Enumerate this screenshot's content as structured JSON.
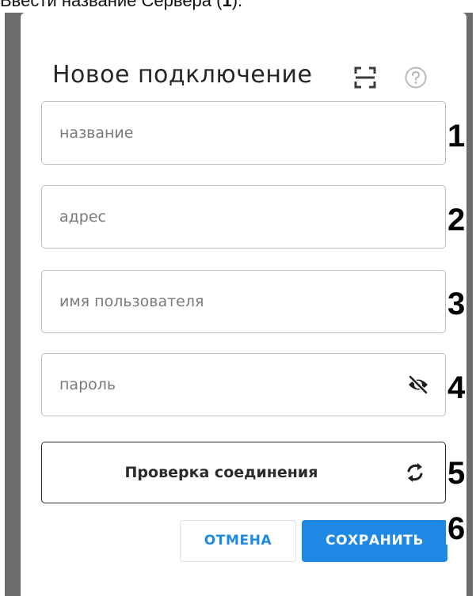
{
  "caption": {
    "text": "Ввести название Сервера (",
    "bold": "1",
    "tail": ")."
  },
  "dialog": {
    "title": "Новое подключение",
    "scan_icon": "qr-scan-icon",
    "help_icon": "help-circle-icon"
  },
  "fields": {
    "name": {
      "placeholder": "название"
    },
    "address": {
      "placeholder": "адрес"
    },
    "username": {
      "placeholder": "имя пользователя"
    },
    "password": {
      "placeholder": "пароль",
      "visibility_icon": "eye-off-icon"
    }
  },
  "check_connection": {
    "label": "Проверка соединения",
    "icon": "refresh-icon"
  },
  "actions": {
    "cancel_label": "ОТМЕНА",
    "save_label": "СОХРАНИТЬ"
  },
  "callouts": [
    "1",
    "2",
    "3",
    "4",
    "5",
    "6"
  ],
  "colors": {
    "accent": "#1e88e5",
    "backdrop": "#6c6c6c",
    "text": "#262626",
    "placeholder": "#7a7a7a"
  }
}
